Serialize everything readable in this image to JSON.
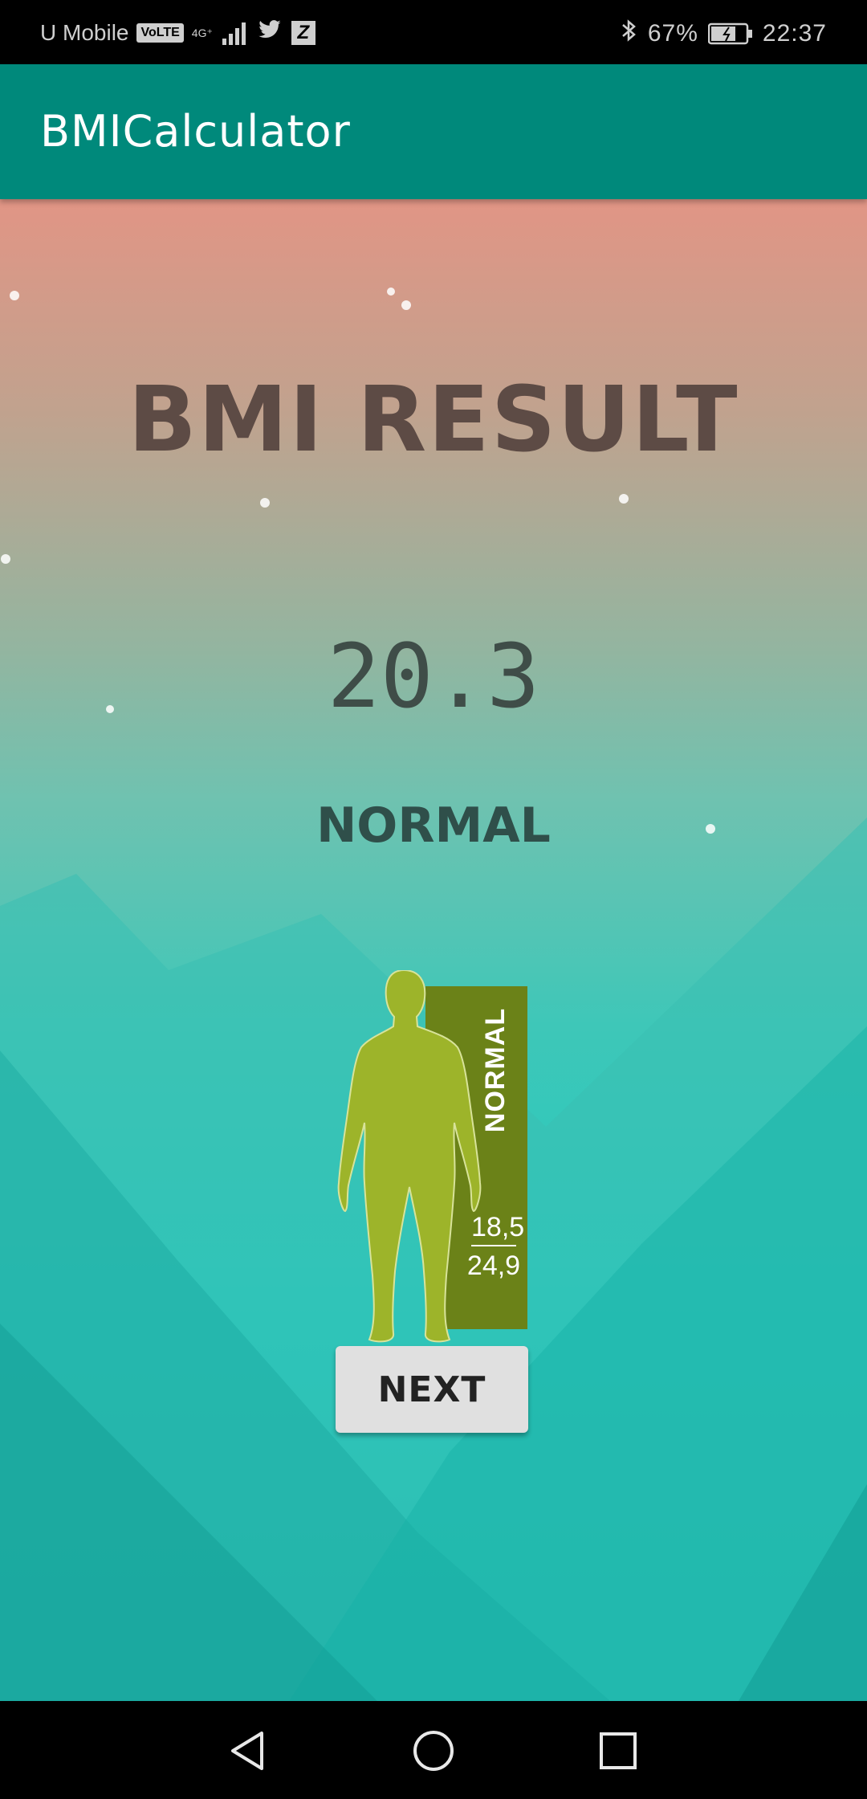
{
  "status_bar": {
    "carrier": "U Mobile",
    "volte": "VoLTE",
    "network": "4G⁺",
    "battery_percent": "67%",
    "time": "22:37"
  },
  "app_bar": {
    "title": "BMICalculator"
  },
  "result": {
    "title": "BMI RESULT",
    "value": "20.3",
    "category": "NORMAL"
  },
  "figure": {
    "band_label": "NORMAL",
    "range_low": "18,5",
    "range_high": "24,9",
    "band_color": "#6b8218",
    "body_color": "#9db42a"
  },
  "actions": {
    "next_label": "NEXT"
  },
  "theme": {
    "app_bar_color": "#00897b",
    "gradient_top": "#e19585",
    "gradient_bottom": "#1cbfb5"
  }
}
